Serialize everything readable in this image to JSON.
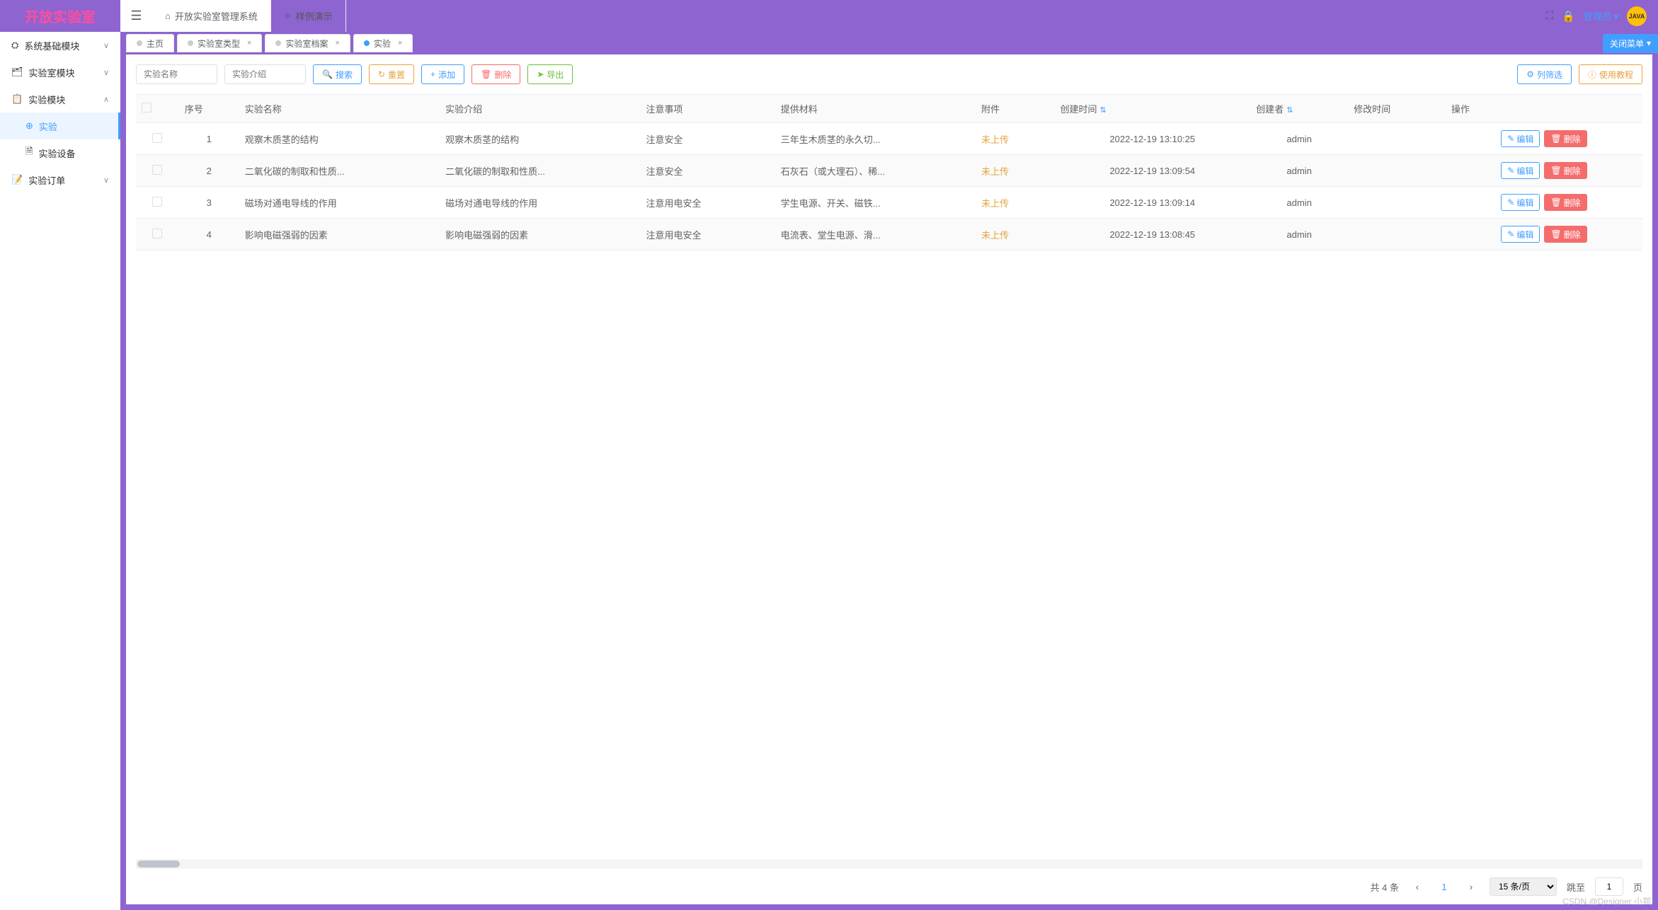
{
  "logo": "开放实验室",
  "header": {
    "system_name": "开放实验室管理系统",
    "demo_link": "样例演示",
    "user_name": "管理员",
    "avatar_text": "JAVA"
  },
  "sidebar": {
    "items": [
      {
        "label": "系统基础模块",
        "icon": "⛭",
        "expanded": false
      },
      {
        "label": "实验室模块",
        "icon": "🗂",
        "expanded": false
      },
      {
        "label": "实验模块",
        "icon": "📋",
        "expanded": true
      },
      {
        "label": "实验订单",
        "icon": "📝",
        "expanded": false
      }
    ],
    "sub_items": [
      {
        "label": "实验",
        "icon": "⊕",
        "active": true
      },
      {
        "label": "实验设备",
        "icon": "🗎",
        "active": false
      }
    ]
  },
  "tabs": [
    {
      "label": "主页",
      "closable": false,
      "active": false
    },
    {
      "label": "实验室类型",
      "closable": true,
      "active": false
    },
    {
      "label": "实验室档案",
      "closable": true,
      "active": false
    },
    {
      "label": "实验",
      "closable": true,
      "active": true
    }
  ],
  "close_all_label": "关闭菜单",
  "toolbar": {
    "input1_placeholder": "实验名称",
    "input2_placeholder": "实验介绍",
    "search": "搜索",
    "reset": "重置",
    "add": "添加",
    "delete": "删除",
    "export": "导出",
    "filter": "列筛选",
    "tutorial": "使用教程"
  },
  "table": {
    "columns": [
      "序号",
      "实验名称",
      "实验介绍",
      "注意事项",
      "提供材料",
      "附件",
      "创建时间",
      "创建者",
      "修改时间",
      "操作"
    ],
    "rows": [
      {
        "seq": "1",
        "name": "观察木质茎的结构",
        "intro": "观察木质茎的结构",
        "note": "注意安全",
        "material": "三年生木质茎的永久切...",
        "file": "未上传",
        "ctime": "2022-12-19 13:10:25",
        "creator": "admin",
        "mtime": ""
      },
      {
        "seq": "2",
        "name": "二氧化碳的制取和性质...",
        "intro": "二氧化碳的制取和性质...",
        "note": "注意安全",
        "material": "石灰石（或大理石）、稀...",
        "file": "未上传",
        "ctime": "2022-12-19 13:09:54",
        "creator": "admin",
        "mtime": ""
      },
      {
        "seq": "3",
        "name": "磁场对通电导线的作用",
        "intro": "磁场对通电导线的作用",
        "note": "注意用电安全",
        "material": "学生电源、开关、磁铁...",
        "file": "未上传",
        "ctime": "2022-12-19 13:09:14",
        "creator": "admin",
        "mtime": ""
      },
      {
        "seq": "4",
        "name": "影响电磁强弱的因素",
        "intro": "影响电磁强弱的因素",
        "note": "注意用电安全",
        "material": "电流表、堂生电源、滑...",
        "file": "未上传",
        "ctime": "2022-12-19 13:08:45",
        "creator": "admin",
        "mtime": ""
      }
    ],
    "edit_label": "编辑",
    "delete_label": "删除"
  },
  "pagination": {
    "total_text": "共 4 条",
    "current_page": "1",
    "page_size": "15 条/页",
    "jump_label": "跳至",
    "jump_value": "1",
    "page_suffix": "页"
  },
  "watermark": "CSDN @Designer 小郑"
}
